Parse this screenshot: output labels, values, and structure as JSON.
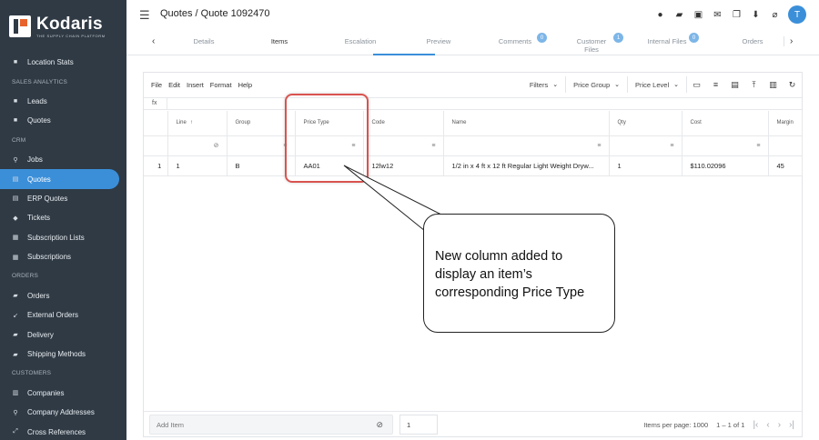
{
  "app": {
    "name": "Kodaris",
    "tagline": "THE SUPPLY CHAIN PLATFORM"
  },
  "header": {
    "title": "Quotes / Quote 1092470",
    "avatar_initial": "T"
  },
  "sidebar": {
    "entries": [
      {
        "type": "item",
        "label": "Location Stats",
        "icon": "square-icon"
      },
      {
        "type": "section",
        "label": "SALES ANALYTICS"
      },
      {
        "type": "item",
        "label": "Leads",
        "icon": "square-icon"
      },
      {
        "type": "item",
        "label": "Quotes",
        "icon": "square-icon"
      },
      {
        "type": "section",
        "label": "CRM"
      },
      {
        "type": "item",
        "label": "Jobs",
        "icon": "pin-icon"
      },
      {
        "type": "item",
        "label": "Quotes",
        "icon": "doc-icon",
        "active": true
      },
      {
        "type": "item",
        "label": "ERP Quotes",
        "icon": "doc-icon"
      },
      {
        "type": "item",
        "label": "Tickets",
        "icon": "tag-icon"
      },
      {
        "type": "item",
        "label": "Subscription Lists",
        "icon": "list-icon"
      },
      {
        "type": "item",
        "label": "Subscriptions",
        "icon": "list-icon"
      },
      {
        "type": "section",
        "label": "ORDERS"
      },
      {
        "type": "item",
        "label": "Orders",
        "icon": "truck-icon"
      },
      {
        "type": "item",
        "label": "External Orders",
        "icon": "arrow-icon"
      },
      {
        "type": "item",
        "label": "Delivery",
        "icon": "truck-icon"
      },
      {
        "type": "item",
        "label": "Shipping Methods",
        "icon": "truck-icon"
      },
      {
        "type": "section",
        "label": "CUSTOMERS"
      },
      {
        "type": "item",
        "label": "Companies",
        "icon": "building-icon"
      },
      {
        "type": "item",
        "label": "Company Addresses",
        "icon": "pin-icon"
      },
      {
        "type": "item",
        "label": "Cross References",
        "icon": "link-icon"
      }
    ]
  },
  "tabs": {
    "items": [
      {
        "label": "Details"
      },
      {
        "label": "Items",
        "active": true
      },
      {
        "label": "Escalation"
      },
      {
        "label": "Preview"
      },
      {
        "label": "Comments",
        "badge": "0"
      },
      {
        "label": "Customer Files",
        "badge": "1"
      },
      {
        "label": "Internal Files",
        "badge": "0"
      },
      {
        "label": "Orders"
      }
    ]
  },
  "menubar": {
    "items": [
      "File",
      "Edit",
      "Insert",
      "Format",
      "Help"
    ]
  },
  "toolbar": {
    "filters": "Filters",
    "price_group": "Price Group",
    "price_level": "Price Level"
  },
  "formula": {
    "label": "fx"
  },
  "grid": {
    "columns": [
      "Line",
      "Group",
      "Price Type",
      "Code",
      "Name",
      "Qty",
      "Cost",
      "Margin"
    ],
    "sort_indicator": "↑",
    "rows": [
      {
        "row_number": "1",
        "cells": [
          "1",
          "B",
          "AA01",
          "12lw12",
          "1/2 in x 4 ft x 12 ft Regular Light Weight Dryw...",
          "1",
          "$110.02096",
          "45"
        ]
      }
    ]
  },
  "annotation": {
    "text": "New column added to\ndisplay an item’s\ncorresponding Price Type",
    "highlight_color": "#d9534f"
  },
  "footer": {
    "add_item_placeholder": "Add Item",
    "qty_value": "1",
    "items_per_page": "Items per page: 1000",
    "range": "1 – 1 of 1"
  },
  "colors": {
    "sidebar_bg": "#2f3a45",
    "accent": "#3b8fd9"
  }
}
